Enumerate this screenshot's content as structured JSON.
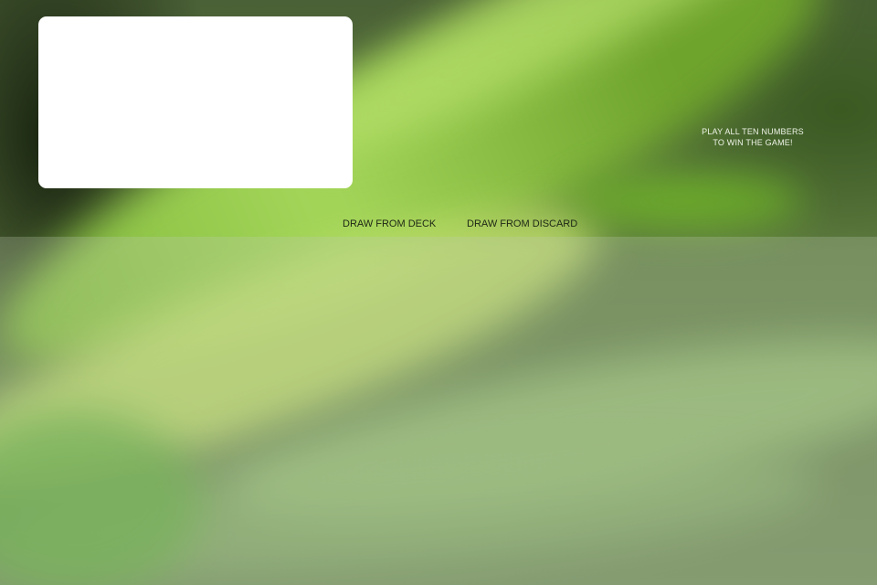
{
  "hint": {
    "line1": "PLAY ALL TEN NUMBERS",
    "line2": "TO WIN THE GAME!"
  },
  "actions": {
    "draw_deck_label": "DRAW FROM DECK",
    "draw_discard_label": "DRAW FROM DISCARD"
  },
  "colors": {
    "panel": "#ffffff",
    "label_text": "#1e2615",
    "hint_text": "#eef3e6"
  }
}
